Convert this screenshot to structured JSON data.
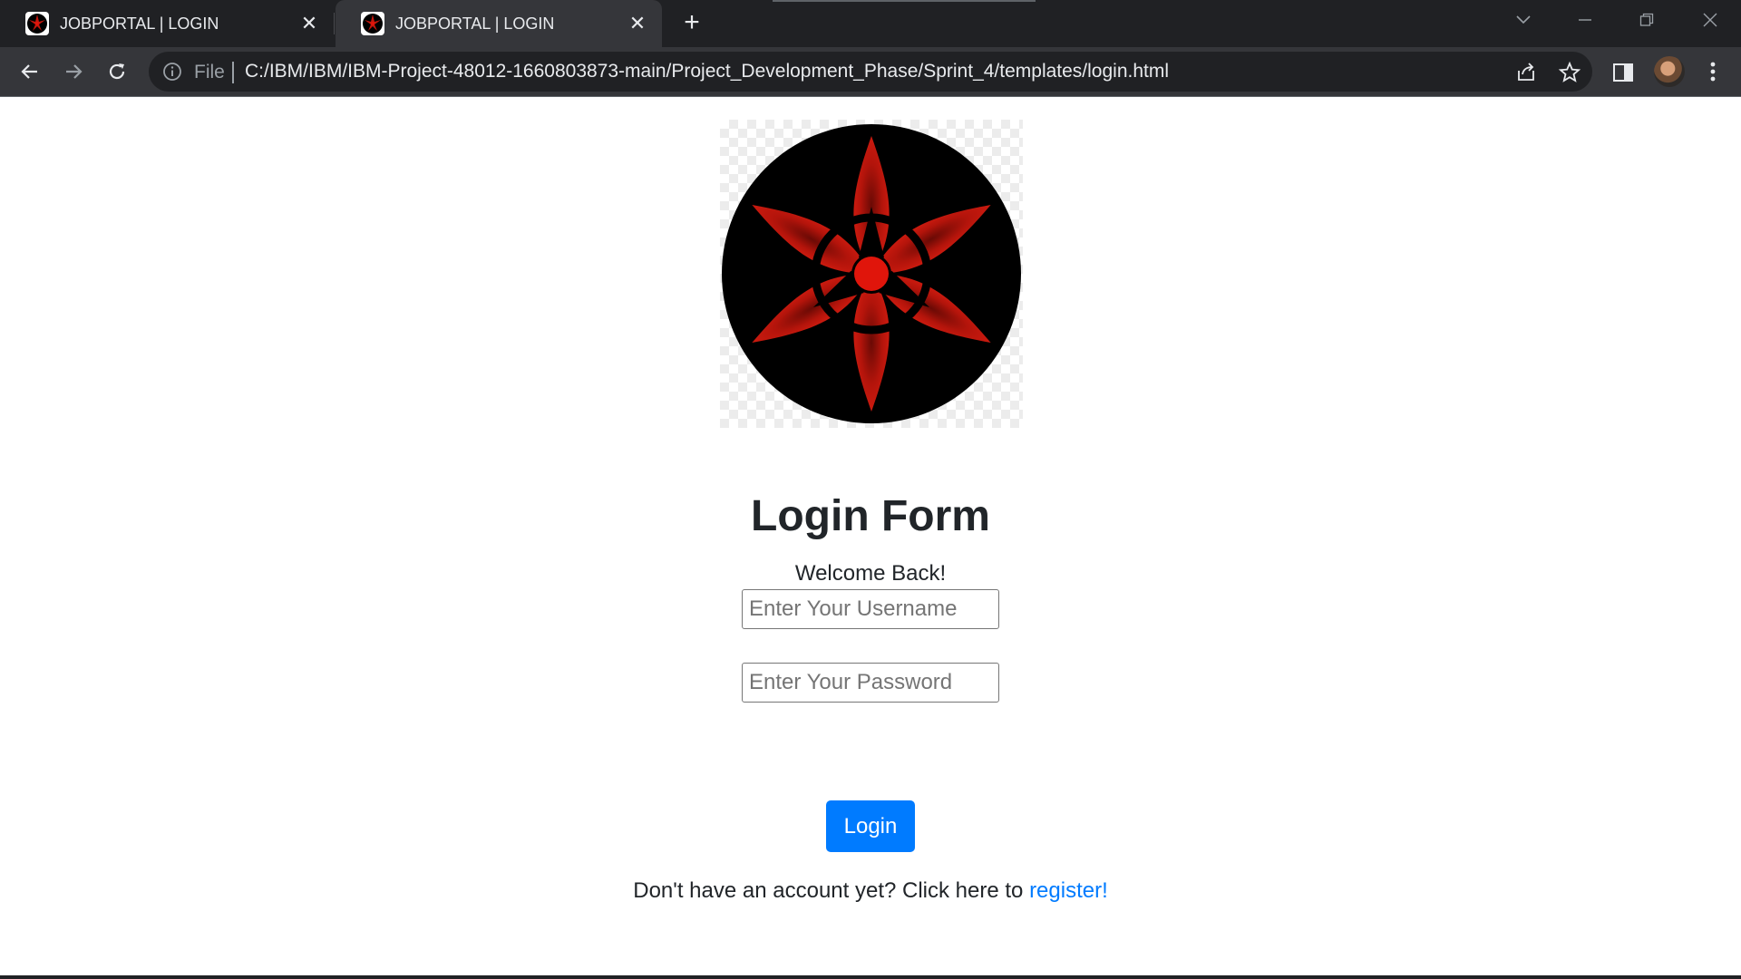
{
  "browser": {
    "tabs": [
      {
        "title": "JOBPORTAL | LOGIN",
        "active": false
      },
      {
        "title": "JOBPORTAL | LOGIN",
        "active": true
      }
    ],
    "close_glyph": "✕",
    "new_tab_glyph": "+",
    "address": {
      "scheme_label": "File",
      "url": "C:/IBM/IBM/IBM-Project-48012-1660803873-main/Project_Development_Phase/Sprint_4/templates/login.html"
    },
    "icons": [
      "tab-favicon-icon",
      "close-icon",
      "new-tab-icon",
      "tab-search-icon",
      "minimize-icon",
      "restore-icon",
      "window-close-icon",
      "back-arrow-icon",
      "forward-arrow-icon",
      "reload-icon",
      "info-icon",
      "share-icon",
      "bookmark-star-icon",
      "side-panel-icon",
      "profile-avatar",
      "kebab-menu-icon"
    ]
  },
  "page": {
    "logo": {
      "name": "sharingan-logo",
      "colors": {
        "circle": "#000000",
        "petals": "#c4160c",
        "center": "#e0150b"
      }
    },
    "form_title": "Login Form",
    "welcome_text": "Welcome Back!",
    "username_placeholder": "Enter Your Username",
    "password_placeholder": "Enter Your Password",
    "login_button": "Login",
    "register_prompt": "Don't have an account yet? Click here to ",
    "register_link": "register!",
    "colors": {
      "primary": "#007bff",
      "text": "#212529"
    }
  }
}
